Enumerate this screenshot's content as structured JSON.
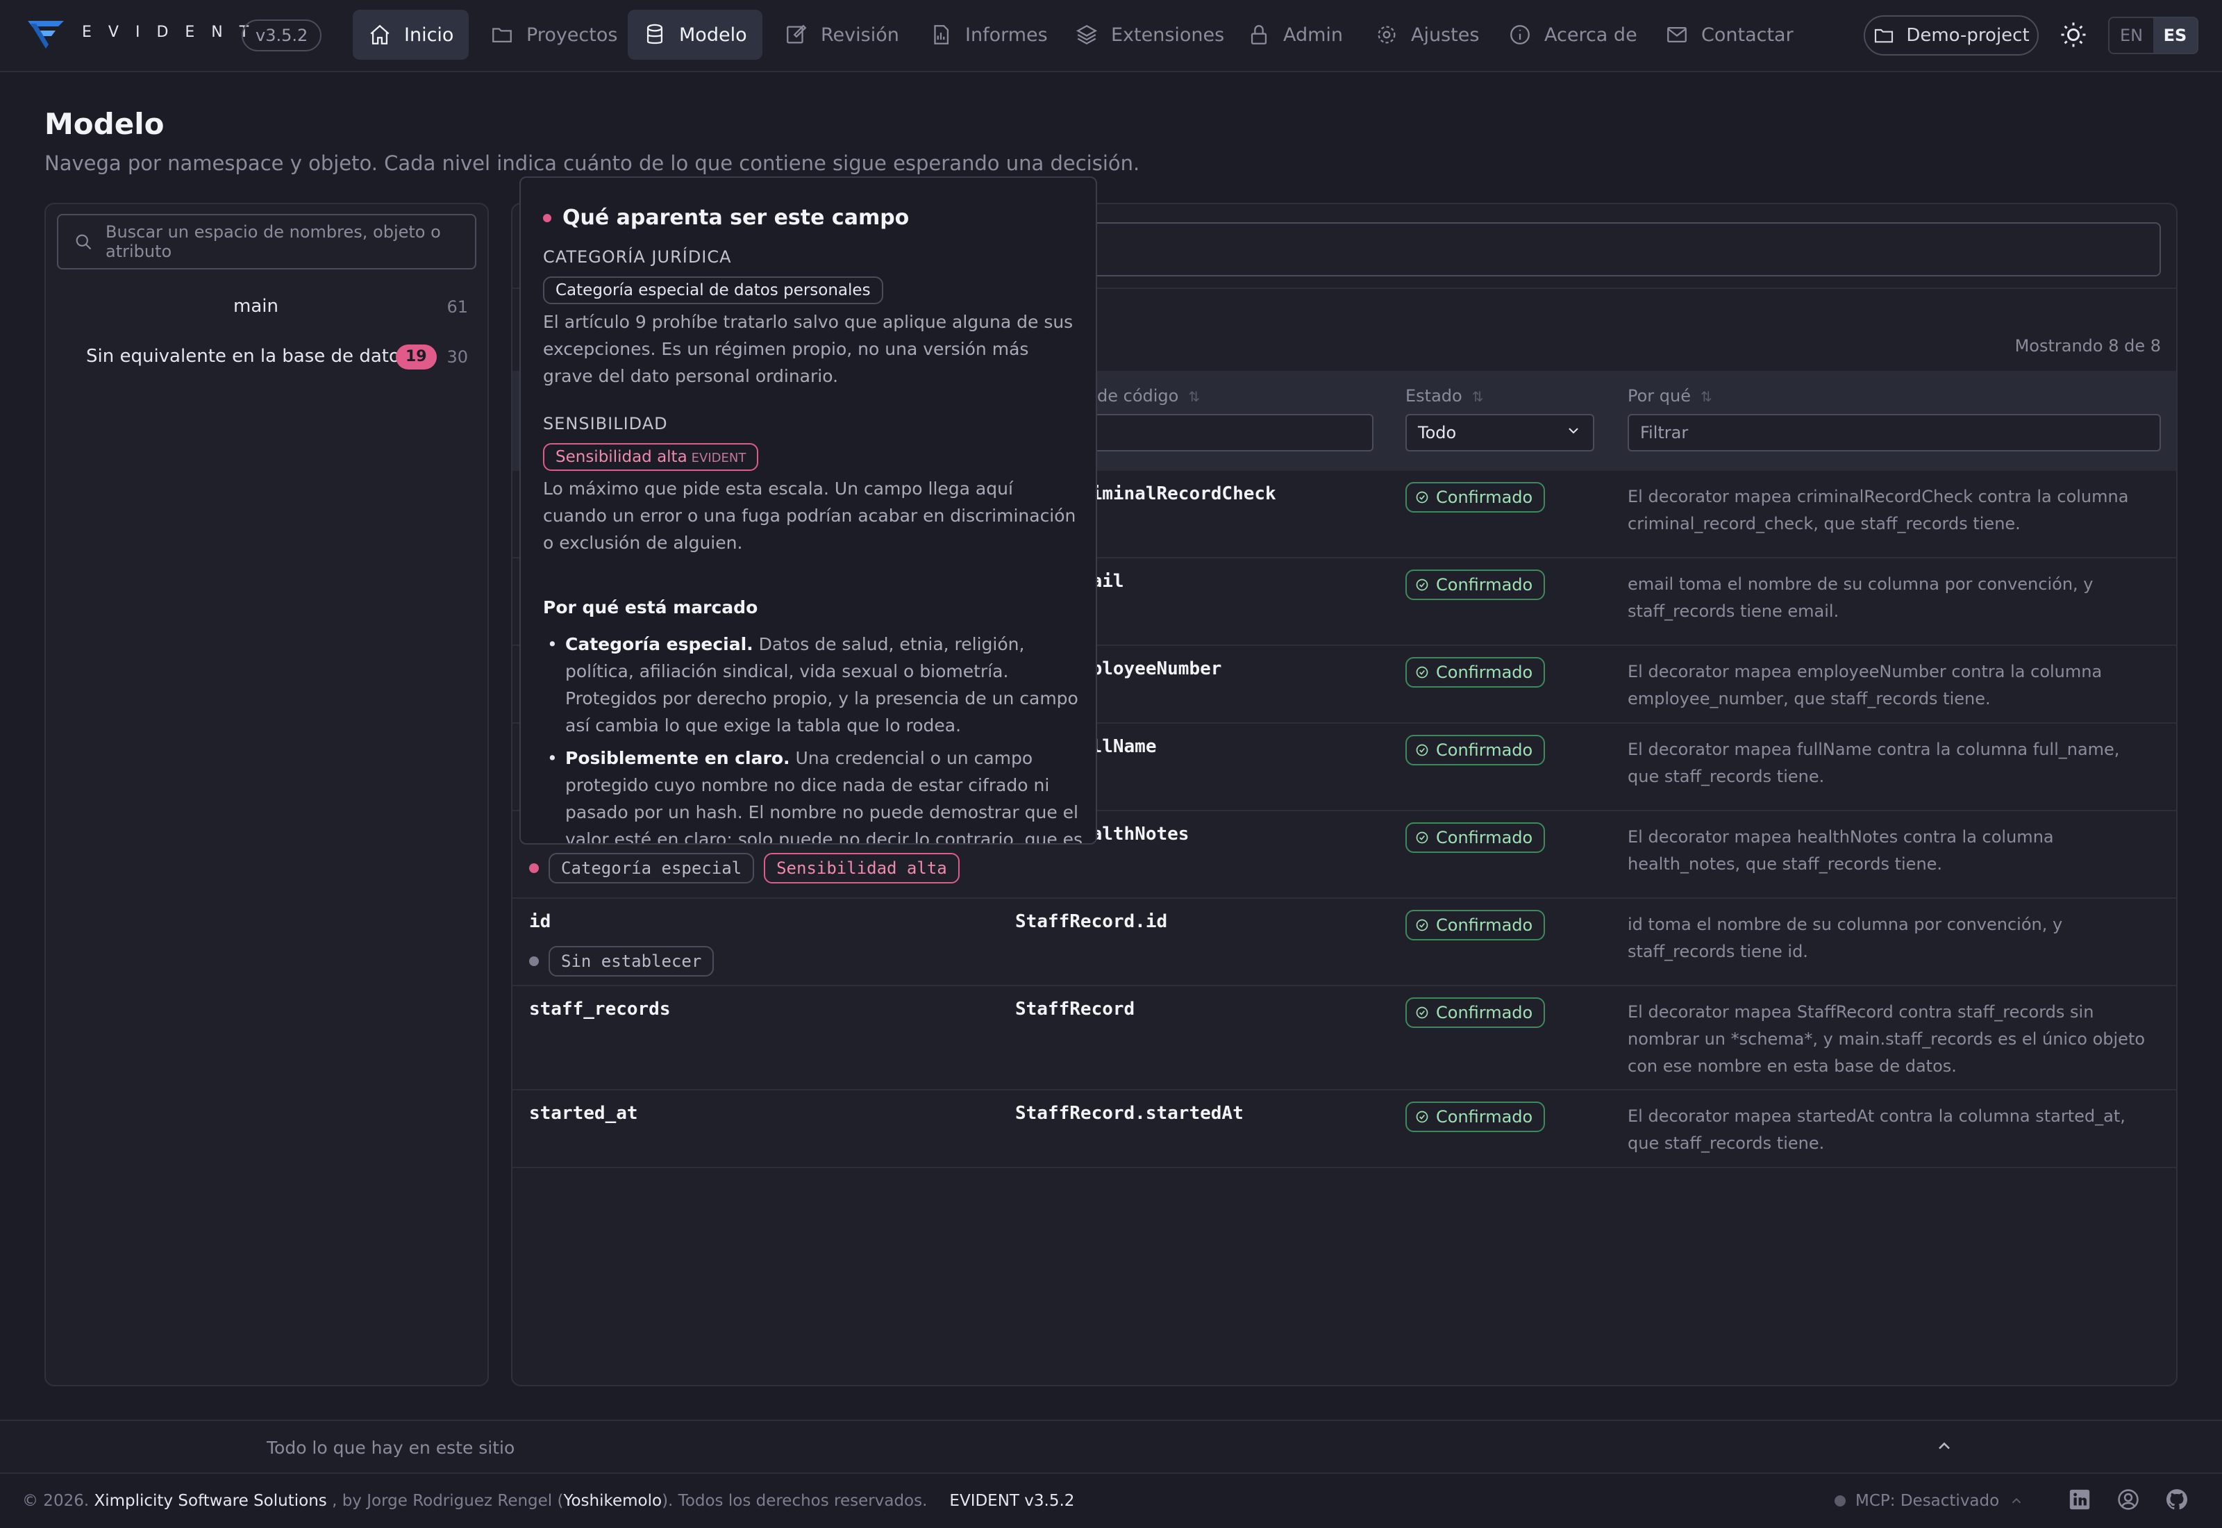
{
  "brand": {
    "name": "EVIDENT",
    "version": "v3.5.2"
  },
  "nav": {
    "items": [
      {
        "label": "Inicio",
        "icon": "home-icon",
        "active": true
      },
      {
        "label": "Proyectos",
        "icon": "folder-icon"
      },
      {
        "label": "Modelo",
        "icon": "database-icon",
        "active": true
      },
      {
        "label": "Revisión",
        "icon": "edit-icon"
      },
      {
        "label": "Informes",
        "icon": "report-icon"
      },
      {
        "label": "Extensiones",
        "icon": "layers-icon"
      },
      {
        "label": "Admin",
        "icon": "lock-icon"
      },
      {
        "label": "Ajustes",
        "icon": "gear-icon"
      },
      {
        "label": "Acerca de",
        "icon": "info-icon"
      },
      {
        "label": "Contactar",
        "icon": "mail-icon"
      }
    ],
    "project": "Demo-project",
    "lang": {
      "en": "EN",
      "es": "ES",
      "selected": "ES"
    }
  },
  "page": {
    "title": "Modelo",
    "subtitle": "Navega por namespace y objeto. Cada nivel indica cuánto de lo que contiene sigue esperando una decisión."
  },
  "tree": {
    "search_placeholder": "Buscar un espacio de nombres, objeto o atributo",
    "items": [
      {
        "label": "main",
        "count": "61"
      },
      {
        "label": "Sin equivalente en la base de datos",
        "badge": "19",
        "count": "30"
      }
    ]
  },
  "table": {
    "showing": "Mostrando 8 de 8",
    "headers": {
      "code": "de código",
      "status": "Estado",
      "why": "Por qué"
    },
    "status_filter": "Todo",
    "why_filter_placeholder": "Filtrar",
    "rows": [
      {
        "name": "",
        "code": "cord.criminalRecordCheck",
        "status": "Confirmado",
        "why": "El decorator mapea criminalRecordCheck contra la columna criminal_record_check, que staff_records tiene."
      },
      {
        "name": "",
        "code": "cord.email",
        "status": "Confirmado",
        "why": "email toma el nombre de su columna por convención, y staff_records tiene email."
      },
      {
        "name": "",
        "code": "cord.employeeNumber",
        "status": "Confirmado",
        "why": "El decorator mapea employeeNumber contra la columna employee_number, que staff_records tiene."
      },
      {
        "name": "",
        "code": "cord.fullName",
        "status": "Confirmado",
        "why": "El decorator mapea fullName contra la columna full_name, que staff_records tiene."
      },
      {
        "name": "",
        "code": "cord.healthNotes",
        "status": "Confirmado",
        "why": "El decorator mapea healthNotes contra la columna health_notes, que staff_records tiene.",
        "tags": [
          "Categoría especial",
          "Sensibilidad alta"
        ]
      },
      {
        "name": "id",
        "code": "StaffRecord.id",
        "status": "Confirmado",
        "why": "id toma el nombre de su columna por convención, y staff_records tiene id.",
        "tags": [
          "Sin establecer"
        ]
      },
      {
        "name": "staff_records",
        "code": "StaffRecord",
        "status": "Confirmado",
        "why": "El decorator mapea StaffRecord contra staff_records sin nombrar un *schema*, y main.staff_records es el único objeto con ese nombre en esta base de datos."
      },
      {
        "name": "started_at",
        "code": "StaffRecord.startedAt",
        "status": "Confirmado",
        "why": "El decorator mapea startedAt contra la columna started_at, que staff_records tiene."
      }
    ]
  },
  "popover": {
    "title": "Qué aparenta ser este campo",
    "legal_label": "CATEGORÍA JURÍDICA",
    "legal_chip": "Categoría especial de datos personales",
    "legal_text": "El artículo 9 prohíbe tratarlo salvo que aplique alguna de sus excepciones. Es un régimen propio, no una versión más grave del dato personal ordinario.",
    "sens_label": "SENSIBILIDAD",
    "sens_chip": "Sensibilidad alta",
    "sens_chip_source": "EVIDENT",
    "sens_text": "Lo máximo que pide esta escala. Un campo llega aquí cuando un error o una fuga podrían acabar en discriminación o exclusión de alguien.",
    "why_heading": "Por qué está marcado",
    "reasons": [
      {
        "bold": "Categoría especial.",
        "text": " Datos de salud, etnia, religión, política, afiliación sindical, vida sexual o biometría. Protegidos por derecho propio, y la presencia de un campo así cambia lo que exige la tabla que lo rodea."
      },
      {
        "bold": "Posiblemente en claro.",
        "text": " Una credencial o un campo protegido cuyo nombre no dice nada de estar cifrado ni pasado por un hash. El nombre no puede demostrar que el valor esté en claro; solo puede no decir lo contrario, que es una pregunta que"
      }
    ]
  },
  "footer": {
    "link": "Todo lo que hay en este sitio",
    "copy_prefix": "© 2026. ",
    "company": "Ximplicity Software Solutions",
    "copy_mid": " , by Jorge Rodriguez Rengel (",
    "author": "Yoshikemolo",
    "copy_end": "). Todos los derechos reservados.",
    "version": "EVIDENT v3.5.2",
    "mcp": "MCP: Desactivado"
  }
}
